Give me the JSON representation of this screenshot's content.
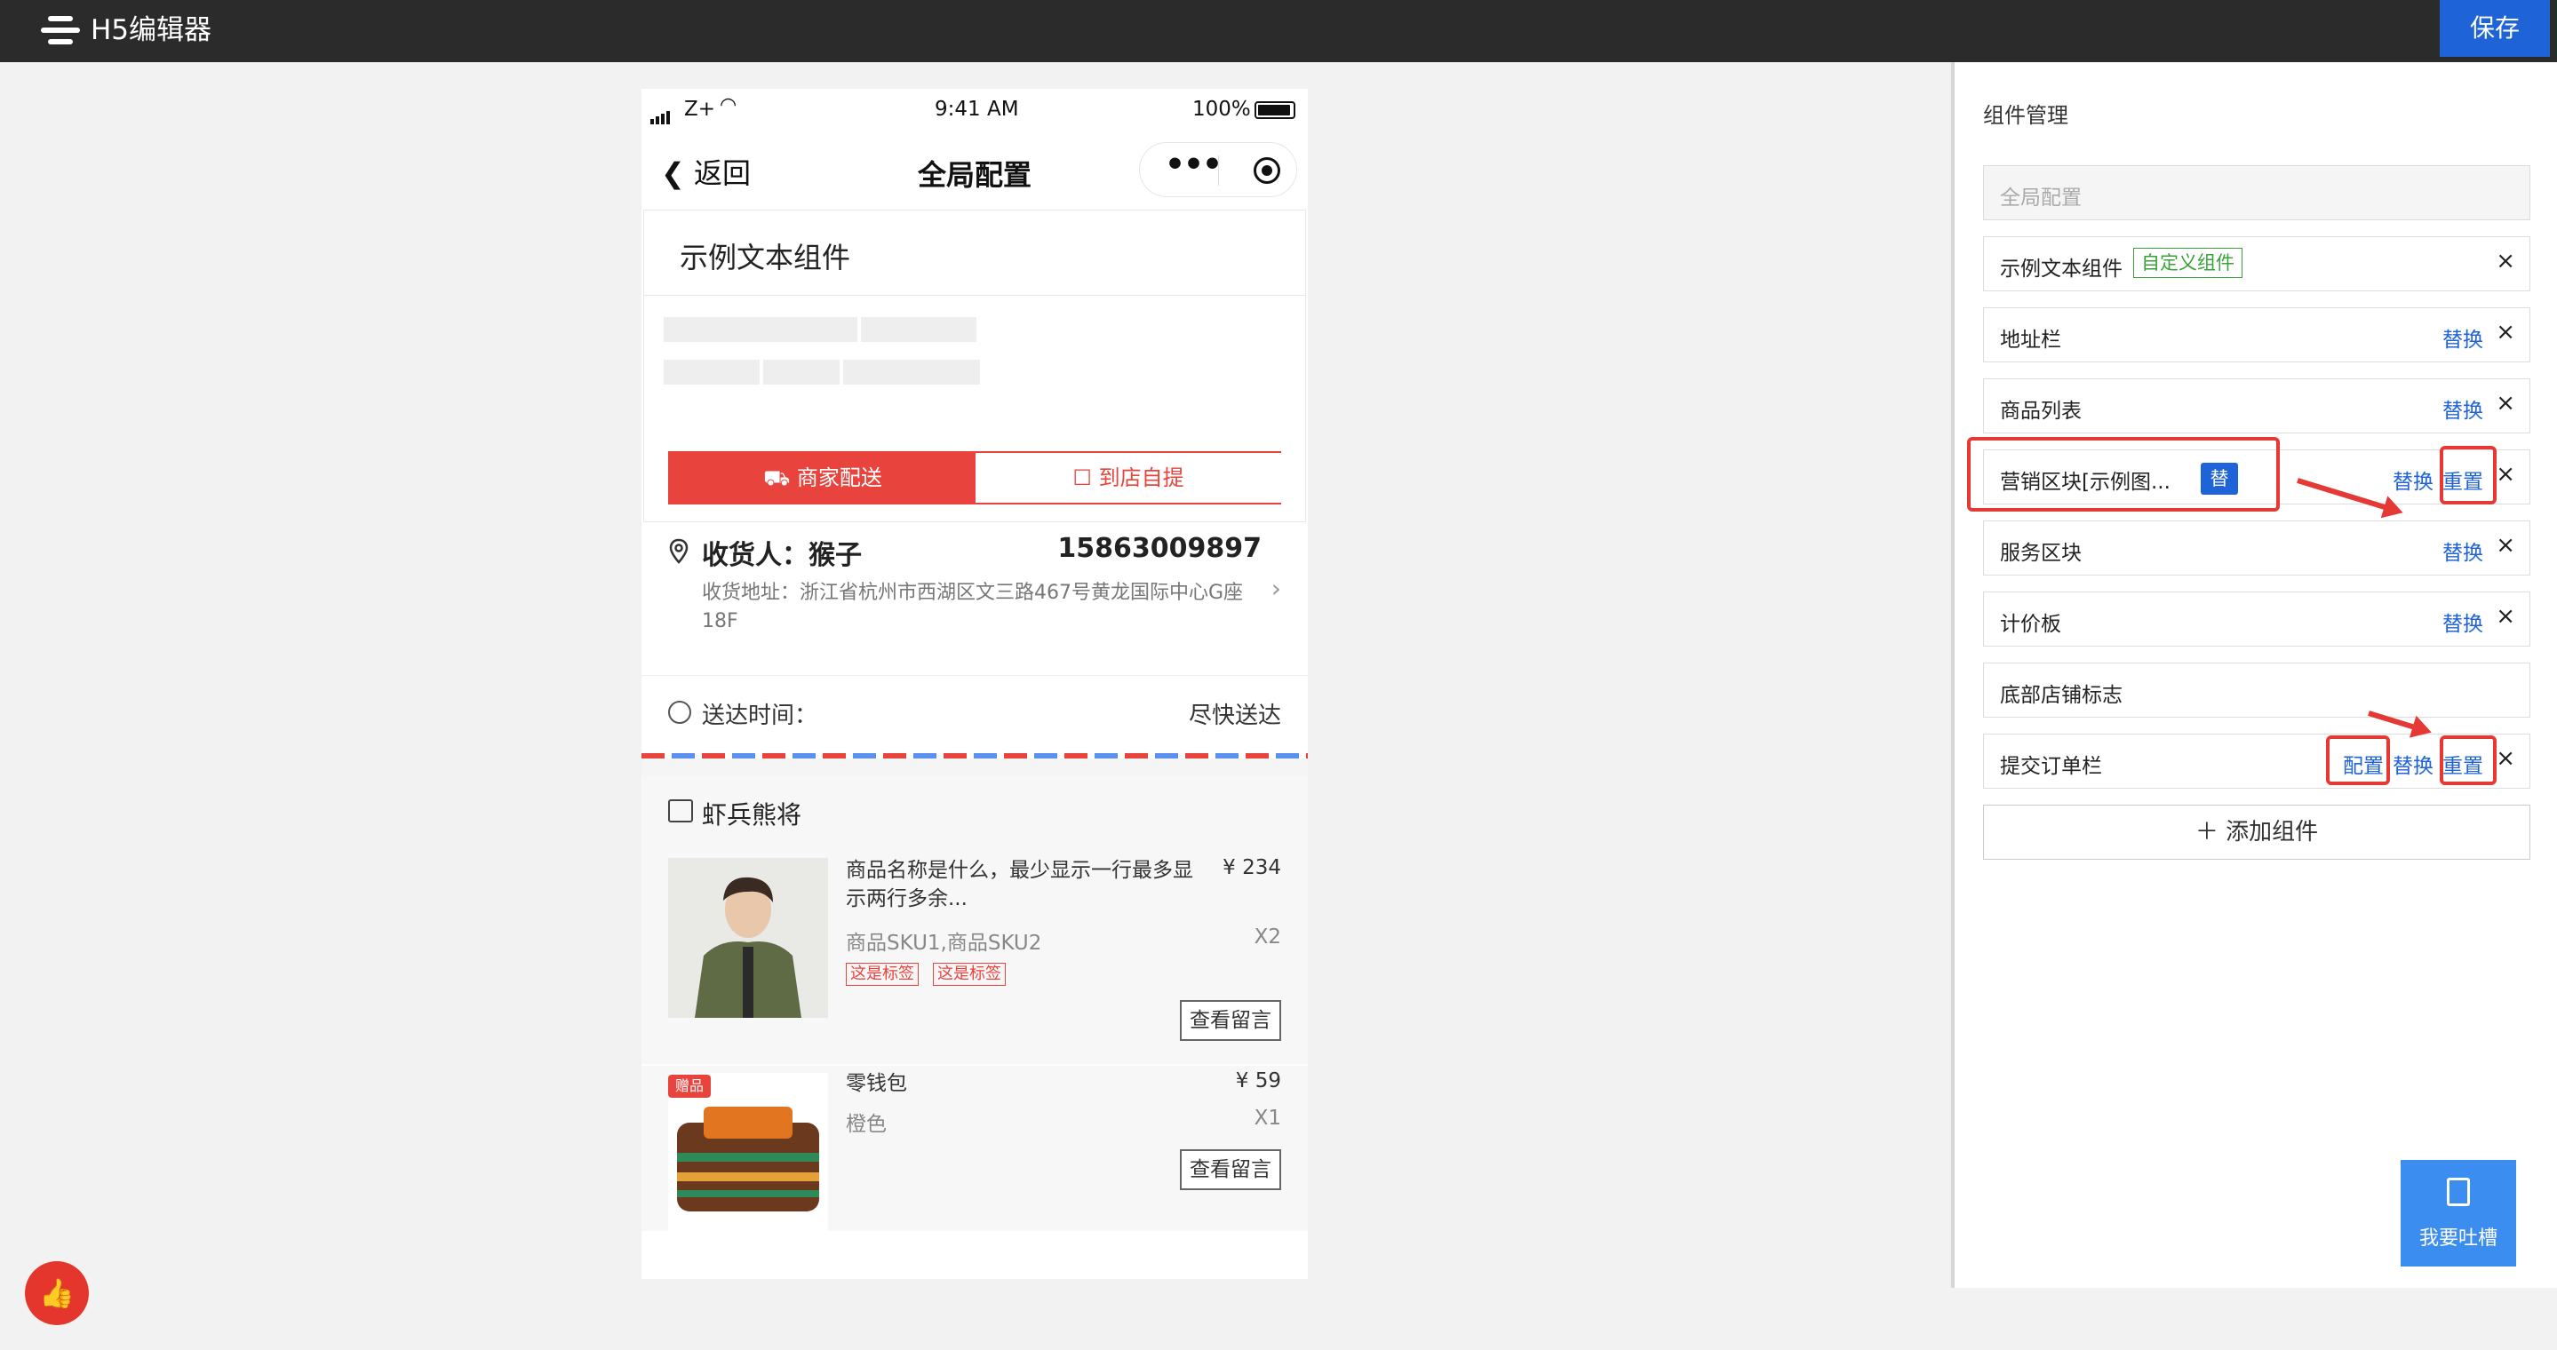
{
  "app": {
    "title": "H5编辑器",
    "save_label": "保存"
  },
  "phone": {
    "status": {
      "carrier": "Z+",
      "time": "9:41 AM",
      "battery": "100%"
    },
    "nav": {
      "back_label": "返回",
      "title": "全局配置",
      "more": "•••"
    },
    "sample_component": {
      "title": "示例文本组件"
    },
    "delivery_tabs": [
      {
        "label": "商家配送",
        "active": true
      },
      {
        "label": "到店自提",
        "active": false
      }
    ],
    "address": {
      "receiver": "收货人：猴子",
      "phone": "15863009897",
      "detail": "收货地址：浙江省杭州市西湖区文三路467号黄龙国际中心G座18F"
    },
    "delivery_time": {
      "label": "送达时间：",
      "value": "尽快送达"
    },
    "shop": {
      "name": "虾兵熊将"
    },
    "goods": [
      {
        "name": "商品名称是什么，最少显示一行最多显示两行多余...",
        "price": "¥ 234",
        "sku": "商品SKU1,商品SKU2",
        "qty": "X2",
        "tags": [
          "这是标签",
          "这是标签"
        ],
        "button": "查看留言"
      },
      {
        "name": "零钱包",
        "price": "¥ 59",
        "sku": "橙色",
        "qty": "X1",
        "gift": "赠品",
        "button": "查看留言"
      }
    ]
  },
  "panel": {
    "title": "组件管理",
    "global_placeholder": "全局配置",
    "components": [
      {
        "label": "示例文本组件",
        "custom_badge": "自定义组件",
        "close": "×"
      },
      {
        "label": "地址栏",
        "replace": "替换",
        "close": "×"
      },
      {
        "label": "商品列表",
        "replace": "替换",
        "close": "×"
      },
      {
        "label": "营销区块[示例图...",
        "badge": "替",
        "replace": "替换",
        "reset": "重置",
        "close": "×"
      },
      {
        "label": "服务区块",
        "replace": "替换",
        "close": "×"
      },
      {
        "label": "计价板",
        "replace": "替换",
        "close": "×"
      },
      {
        "label": "底部店铺标志"
      },
      {
        "label": "提交订单栏",
        "config": "配置",
        "replace": "替换",
        "reset": "重置",
        "close": "×"
      }
    ],
    "add_button": "＋  添加组件"
  },
  "feedback": {
    "label": "我要吐槽"
  },
  "colors": {
    "topbar": "#2b2b2b",
    "primary": "#1e63d8",
    "accent_red": "#e9433e",
    "annotation_red": "#e53935"
  }
}
